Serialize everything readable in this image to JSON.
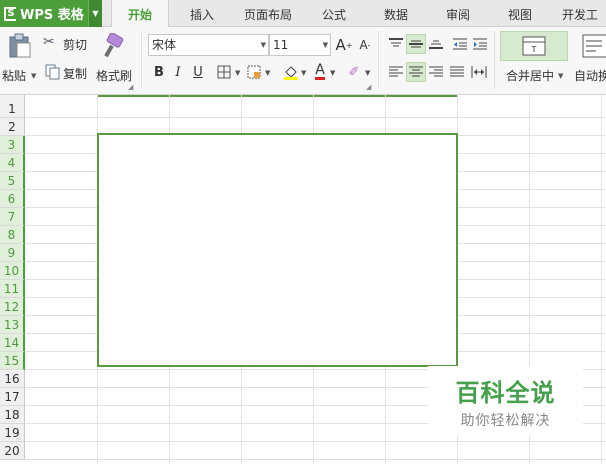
{
  "app": {
    "logo_text": "WPS 表格",
    "accent_color": "#4b9e3a"
  },
  "tabs": [
    {
      "label": "开始",
      "active": true
    },
    {
      "label": "插入"
    },
    {
      "label": "页面布局"
    },
    {
      "label": "公式"
    },
    {
      "label": "数据"
    },
    {
      "label": "审阅"
    },
    {
      "label": "视图"
    },
    {
      "label": "开发工具"
    }
  ],
  "ribbon": {
    "paste_label": "粘贴",
    "cut_label": "剪切",
    "copy_label": "复制",
    "format_painter_label": "格式刷",
    "font_name": "宋体",
    "font_size": "11",
    "grow_font": "A",
    "shrink_font": "A",
    "bold": "B",
    "italic": "I",
    "underline": "U",
    "font_color_glyph": "A",
    "merge_center_label": "合并居中",
    "wrap_text_label": "自动换行"
  },
  "sheet": {
    "row_numbers": [
      "1",
      "2",
      "3",
      "4",
      "5",
      "6",
      "7",
      "8",
      "9",
      "10",
      "11",
      "12",
      "13",
      "14",
      "15",
      "16",
      "17",
      "18",
      "19",
      "20"
    ],
    "selected_rows": [
      "3",
      "4",
      "5",
      "6",
      "7",
      "8",
      "9",
      "10",
      "11",
      "12",
      "13",
      "14",
      "15"
    ]
  },
  "watermark": {
    "title": "百科全说",
    "subtitle": "助你轻松解决"
  }
}
